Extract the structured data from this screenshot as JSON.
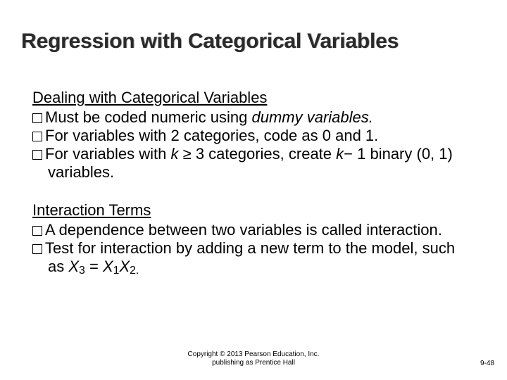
{
  "title": "Regression with Categorical Variables",
  "section1": {
    "heading": "Dealing with Categorical Variables",
    "b1_a": "Must be coded numeric using ",
    "b1_b": "dummy variables.",
    "b2": "For variables with 2 categories, code as 0 and 1.",
    "b3_a": "For variables with ",
    "b3_b": "k",
    "b3_c": " ≥ 3 categories, create ",
    "b3_d": "k",
    "b3_e": "− 1 binary (0, 1) variables."
  },
  "section2": {
    "heading": "Interaction Terms",
    "b1": "A dependence between two variables is called interaction.",
    "b2_a": "Test for interaction by adding a new term to the model, such as ",
    "b2_b": "X",
    "b2_c": "3",
    "b2_d": " = ",
    "b2_e": "X",
    "b2_f": "1",
    "b2_g": "X",
    "b2_h": "2.",
    "b2_end": ""
  },
  "footer": {
    "line1": "Copyright © 2013 Pearson Education, Inc.",
    "line2": "publishing as Prentice Hall",
    "page": "9-48"
  }
}
